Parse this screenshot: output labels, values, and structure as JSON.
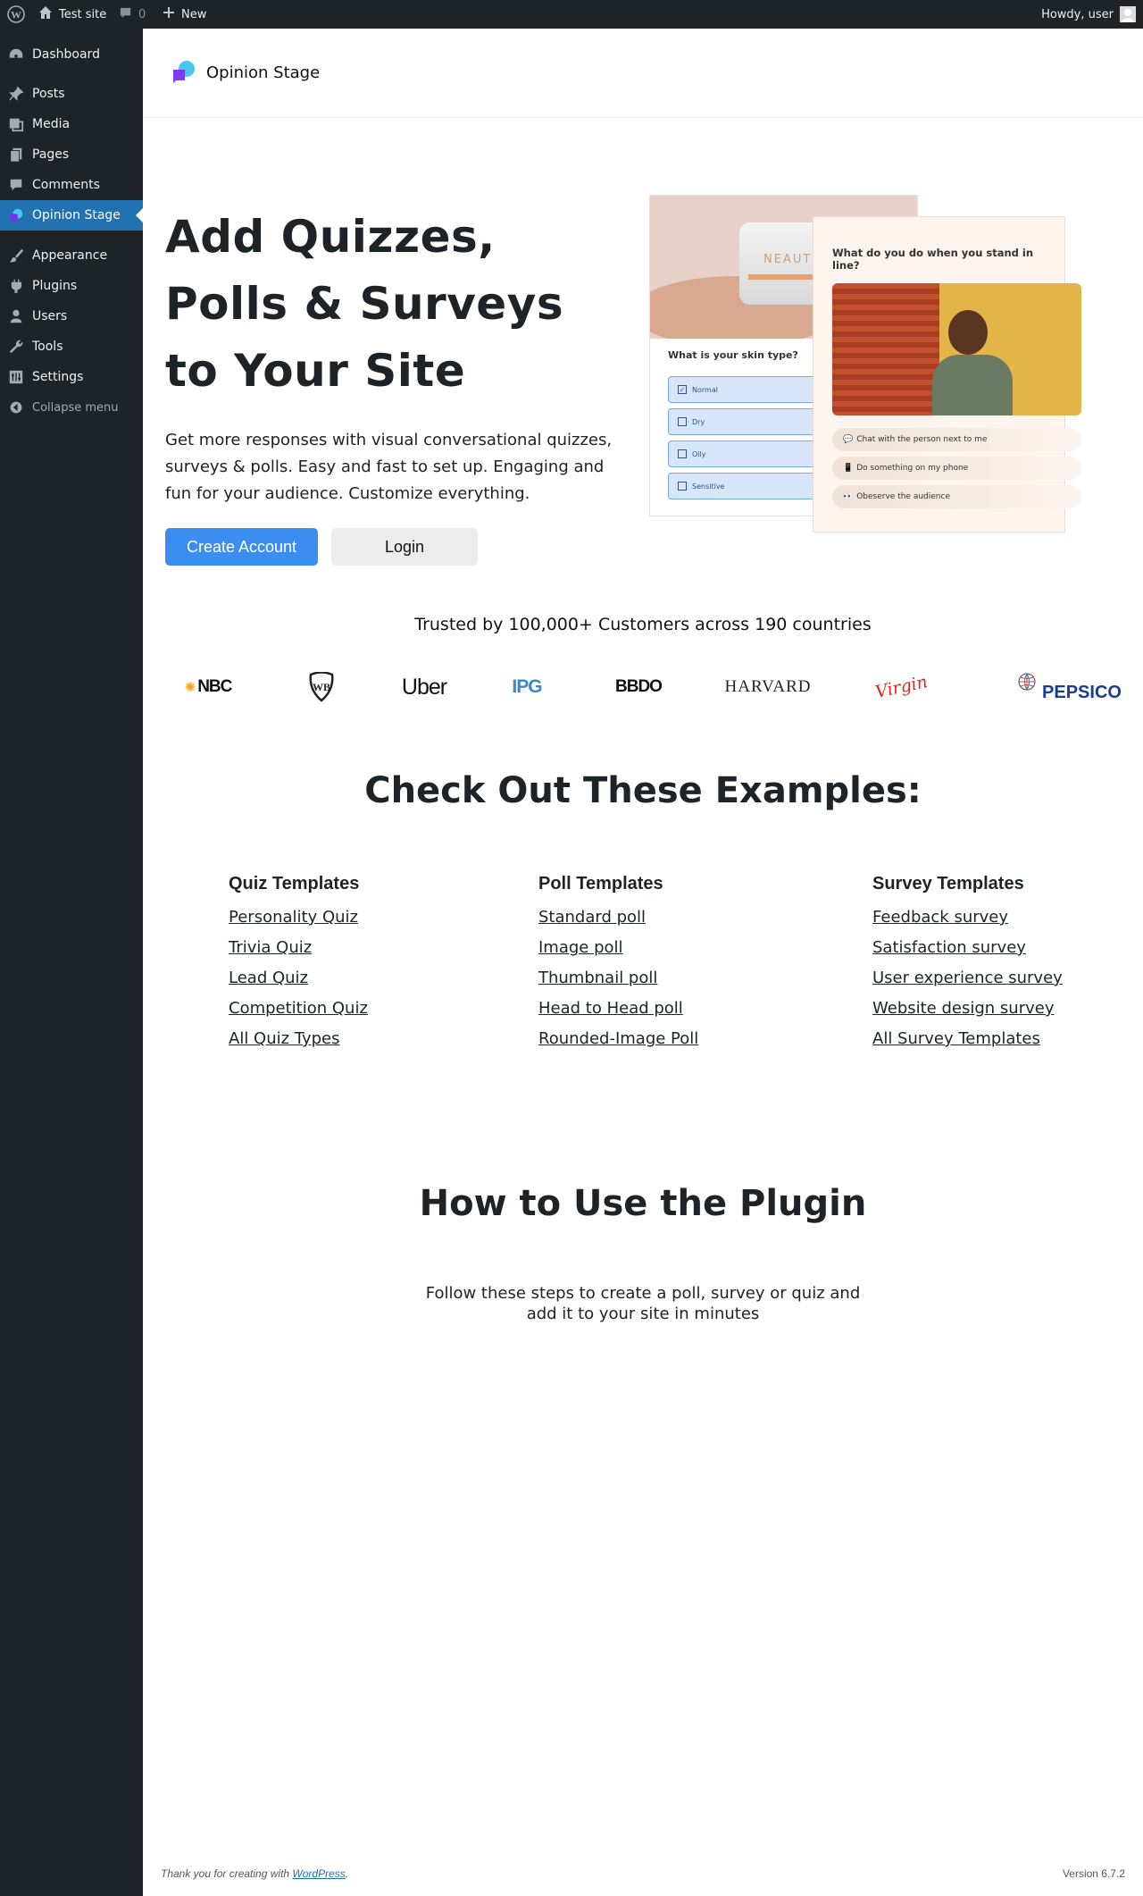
{
  "admin_bar": {
    "site_name": "Test site",
    "comments_count": "0",
    "new_label": "New",
    "greeting": "Howdy, user"
  },
  "sidebar": {
    "items": [
      {
        "label": "Dashboard",
        "icon": "dashboard-icon"
      },
      {
        "label": "Posts",
        "icon": "pin-icon"
      },
      {
        "label": "Media",
        "icon": "media-icon"
      },
      {
        "label": "Pages",
        "icon": "pages-icon"
      },
      {
        "label": "Comments",
        "icon": "comment-icon"
      },
      {
        "label": "Opinion Stage",
        "icon": "opinion-stage-icon",
        "active": true
      },
      {
        "label": "Appearance",
        "icon": "brush-icon"
      },
      {
        "label": "Plugins",
        "icon": "plug-icon"
      },
      {
        "label": "Users",
        "icon": "user-icon"
      },
      {
        "label": "Tools",
        "icon": "wrench-icon"
      },
      {
        "label": "Settings",
        "icon": "settings-icon"
      }
    ],
    "collapse_label": "Collapse menu"
  },
  "brand": {
    "name": "Opinion Stage"
  },
  "hero": {
    "title": "Add Quizzes, Polls & Surveys to Your Site",
    "subtitle": "Get more responses with visual conversational quizzes, surveys & polls. Easy and fast to set up. Engaging and fun for your audience. Customize everything.",
    "create_account_label": "Create Account",
    "login_label": "Login",
    "preview_left": {
      "question": "What is your skin type?",
      "jar_text": "NEAUTHY",
      "options": [
        "Normal",
        "Dry",
        "Oily",
        "Sensitive"
      ]
    },
    "preview_right": {
      "question": "What do you do when you stand in line?",
      "options": [
        "Chat with the person next to me",
        "Do something on my phone",
        "Obeserve the audience"
      ]
    }
  },
  "trusted": {
    "text": "Trusted by 100,000+ Customers across 190 countries",
    "logos": [
      "NBC",
      "WB",
      "Uber",
      "IPG",
      "BBDO",
      "HARVARD",
      "Virgin",
      "PEPSICO"
    ]
  },
  "examples": {
    "title": "Check Out These Examples:",
    "columns": [
      {
        "heading": "Quiz Templates",
        "links": [
          "Personality Quiz",
          "Trivia Quiz",
          "Lead Quiz",
          "Competition Quiz",
          "All Quiz Types"
        ]
      },
      {
        "heading": "Poll Templates",
        "links": [
          "Standard poll",
          "Image poll",
          "Thumbnail poll",
          "Head to Head poll",
          "Rounded-Image Poll"
        ]
      },
      {
        "heading": "Survey Templates",
        "links": [
          "Feedback survey",
          "Satisfaction survey",
          "User experience survey",
          "Website design survey",
          "All Survey Templates"
        ]
      }
    ]
  },
  "how_to": {
    "title": "How to Use the Plugin",
    "subtitle": "Follow these steps to create a poll, survey or quiz and add it to your site in minutes"
  },
  "footer": {
    "thanks_prefix": "Thank you for creating with",
    "wordpress_link": "WordPress",
    "thanks_suffix": ".",
    "version": "Version 6.7.2"
  },
  "colors": {
    "admin_dark": "#1d2327",
    "accent_blue": "#2271b1",
    "button_blue": "#3b8ef0",
    "login_gray": "#ececec"
  }
}
